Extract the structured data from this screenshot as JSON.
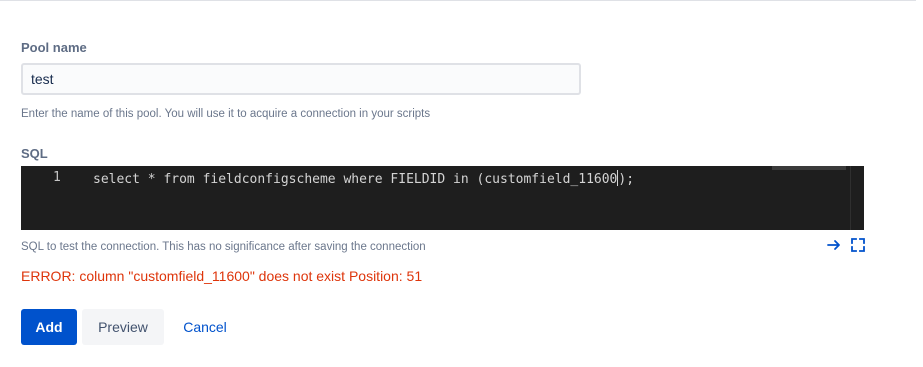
{
  "pool_name": {
    "label": "Pool name",
    "value": "test",
    "help": "Enter the name of this pool. You will use it to acquire a connection in your scripts"
  },
  "sql": {
    "label": "SQL",
    "line_number": "1",
    "code_before_cursor": "select * from fieldconfigscheme where FIELDID in (customfield_11600",
    "code_after_cursor": ");",
    "help": "SQL to test the connection. This has no significance after saving the connection"
  },
  "error": {
    "message": "ERROR: column \"customfield_11600\" does not exist Position: 51",
    "color": "#de350b"
  },
  "editor_tools": {
    "icons": [
      "arrow-right-icon",
      "expand-icon"
    ]
  },
  "actions": {
    "add_label": "Add",
    "preview_label": "Preview",
    "cancel_label": "Cancel"
  },
  "colors": {
    "primary": "#0052cc",
    "editor_background": "#1e1e1e"
  }
}
